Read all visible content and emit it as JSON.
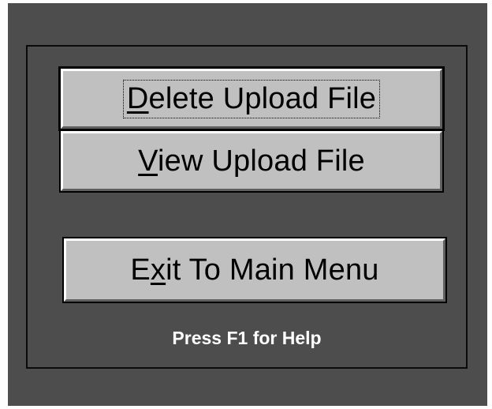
{
  "menu": {
    "buttons": [
      {
        "pre": "",
        "mnemonic": "D",
        "post": "elete Upload File"
      },
      {
        "pre": "",
        "mnemonic": "V",
        "post": "iew Upload File"
      },
      {
        "pre": "E",
        "mnemonic": "x",
        "post": "it To Main Menu"
      }
    ],
    "help_text": "Press F1 for Help"
  }
}
